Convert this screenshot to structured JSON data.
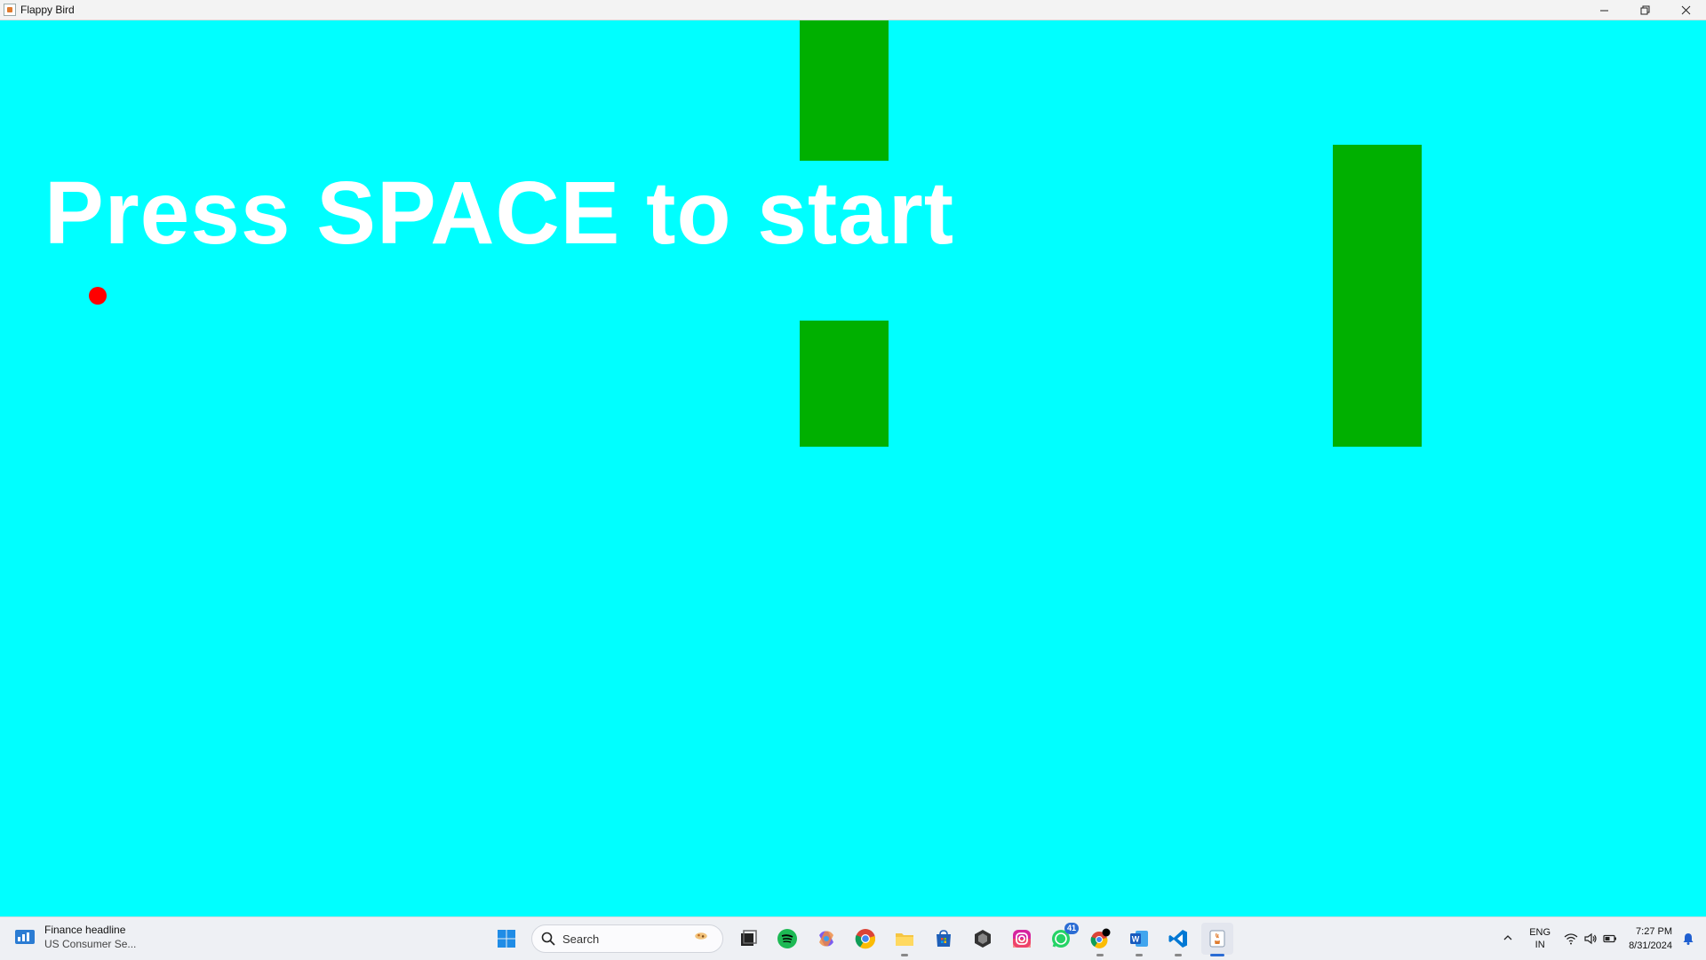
{
  "window": {
    "title": "Flappy Bird"
  },
  "game": {
    "prompt_text": "Press SPACE to start",
    "background_color": "#00ffff",
    "pipe_color": "#00b000",
    "bird_color": "#ff0000",
    "text_color": "#ffffff"
  },
  "taskbar": {
    "news": {
      "title": "Finance headline",
      "subtitle": "US Consumer Se..."
    },
    "search_placeholder": "Search",
    "whatsapp_badge": "41",
    "apps": [
      "start-icon",
      "search-icon",
      "task-view-icon",
      "spotify-icon",
      "copilot-icon",
      "chrome-icon",
      "file-explorer-icon",
      "microsoft-store-icon",
      "unity-icon",
      "instagram-icon",
      "whatsapp-icon",
      "chrome-profile-icon",
      "word-icon",
      "vscode-icon",
      "java-icon"
    ],
    "language_line1": "ENG",
    "language_line2": "IN",
    "time": "7:27 PM",
    "date": "8/31/2024"
  }
}
